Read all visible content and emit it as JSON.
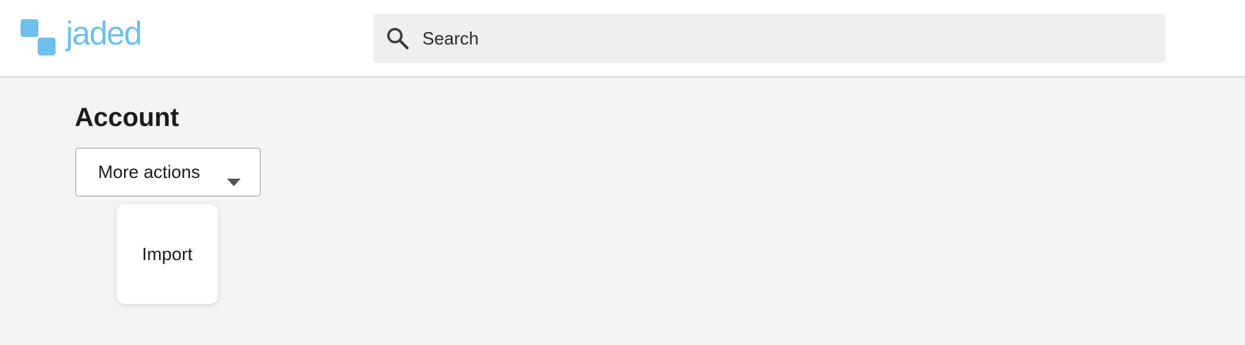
{
  "brand": {
    "name": "jaded",
    "color": "#6cc0ea"
  },
  "search": {
    "placeholder": "Search",
    "icon": "search-icon"
  },
  "page": {
    "title": "Account"
  },
  "actions": {
    "more_actions_label": "More actions",
    "caret_icon": "chevron-down-icon",
    "menu_items": [
      {
        "label": "Import"
      }
    ]
  }
}
